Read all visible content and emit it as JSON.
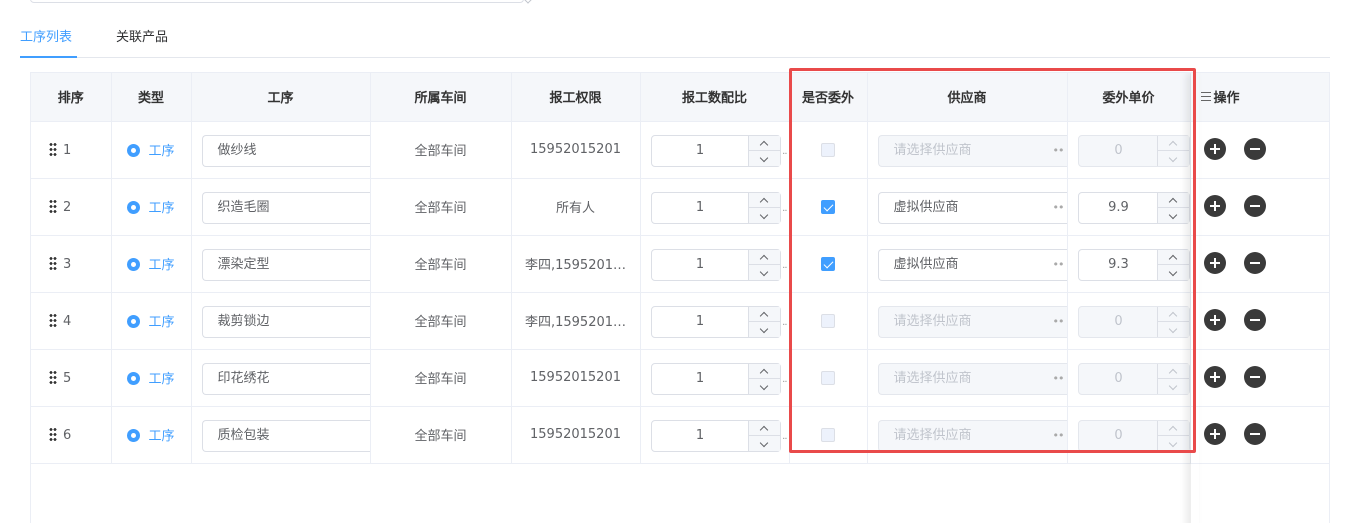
{
  "tabs": [
    {
      "label": "工序列表",
      "active": true
    },
    {
      "label": "关联产品",
      "active": false
    }
  ],
  "columns": {
    "sort": "排序",
    "type": "类型",
    "process": "工序",
    "workshop": "所属车间",
    "permission": "报工权限",
    "ratio": "报工数配比",
    "outsource": "是否委外",
    "supplier": "供应商",
    "price": "委外单价",
    "ops": "操作"
  },
  "supplier_placeholder": "请选择供应商",
  "rows": [
    {
      "sort": "1",
      "type": "工序",
      "process": "做纱线",
      "workshop": "全部车间",
      "permission": "15952015201",
      "ratio": "1",
      "outsourced": false,
      "supplier": "",
      "price": "0"
    },
    {
      "sort": "2",
      "type": "工序",
      "process": "织造毛圈",
      "workshop": "全部车间",
      "permission": "所有人",
      "ratio": "1",
      "outsourced": true,
      "supplier": "虚拟供应商",
      "price": "9.9"
    },
    {
      "sort": "3",
      "type": "工序",
      "process": "漂染定型",
      "workshop": "全部车间",
      "permission": "李四,1595201…",
      "ratio": "1",
      "outsourced": true,
      "supplier": "虚拟供应商",
      "price": "9.3"
    },
    {
      "sort": "4",
      "type": "工序",
      "process": "裁剪锁边",
      "workshop": "全部车间",
      "permission": "李四,1595201…",
      "ratio": "1",
      "outsourced": false,
      "supplier": "",
      "price": "0"
    },
    {
      "sort": "5",
      "type": "工序",
      "process": "印花绣花",
      "workshop": "全部车间",
      "permission": "15952015201",
      "ratio": "1",
      "outsourced": false,
      "supplier": "",
      "price": "0"
    },
    {
      "sort": "6",
      "type": "工序",
      "process": "质检包装",
      "workshop": "全部车间",
      "permission": "15952015201",
      "ratio": "1",
      "outsourced": false,
      "supplier": "",
      "price": "0"
    }
  ],
  "colors": {
    "accent": "#409eff",
    "highlight": "#e94a4a",
    "op_button": "#3a3a3a"
  }
}
